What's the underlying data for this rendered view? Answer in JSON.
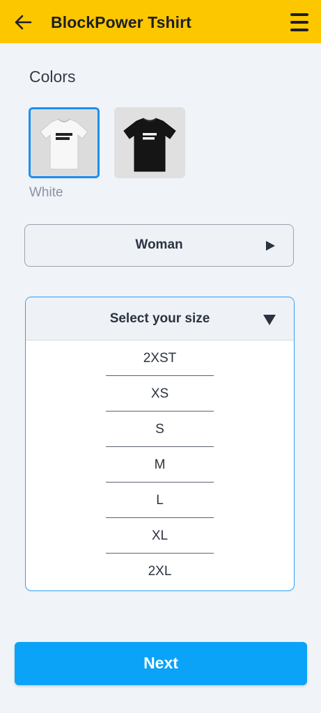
{
  "header": {
    "title": "BlockPower Tshirt",
    "back_icon": "arrow-left-icon",
    "menu_icon": "hamburger-menu-icon",
    "background": "#fdc700"
  },
  "colors": {
    "section_title": "Colors",
    "options": [
      {
        "name": "White",
        "shirt_color": "#f4f4f4",
        "print_text": "BLOCK POWER",
        "selected": true
      },
      {
        "name": "Black",
        "shirt_color": "#151515",
        "print_text": "BLOCK POWER",
        "selected": false
      }
    ],
    "selected_label": "White"
  },
  "gender": {
    "label": "Woman",
    "icon": "play-right-arrow-icon"
  },
  "size": {
    "header_label": "Select your size",
    "icon": "caret-down-icon",
    "options": [
      "2XST",
      "XS",
      "S",
      "M",
      "L",
      "XL",
      "2XL"
    ]
  },
  "footer": {
    "next_label": "Next",
    "accent": "#0aa3f7"
  }
}
